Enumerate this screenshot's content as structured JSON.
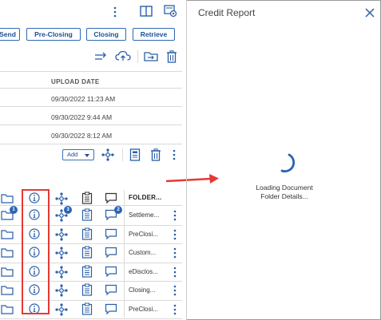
{
  "toolbar": {
    "buttons": [
      "Send",
      "Pre-Closing",
      "Closing",
      "Retrieve"
    ]
  },
  "documents": {
    "column_header": "UPLOAD DATE",
    "dates": [
      "09/30/2022 11:23 AM",
      "09/30/2022 9:44 AM",
      "09/30/2022 8:12 AM"
    ],
    "add_label": "Add"
  },
  "folders": {
    "header": "FOLDER...",
    "rows": [
      {
        "name": "Settleme...",
        "folder_badge": "1",
        "workflow_badge": "3",
        "comment_badge": "2"
      },
      {
        "name": "PreClosi...",
        "folder_badge": "",
        "workflow_badge": "",
        "comment_badge": ""
      },
      {
        "name": "Custom...",
        "folder_badge": "",
        "workflow_badge": "",
        "comment_badge": ""
      },
      {
        "name": "eDisclos...",
        "folder_badge": "",
        "workflow_badge": "",
        "comment_badge": ""
      },
      {
        "name": "Closing...",
        "folder_badge": "",
        "workflow_badge": "",
        "comment_badge": ""
      },
      {
        "name": "PreClosi...",
        "folder_badge": "",
        "workflow_badge": "",
        "comment_badge": ""
      }
    ]
  },
  "panel": {
    "title": "Credit Report",
    "loading_line1": "Loading Document",
    "loading_line2": "Folder Details..."
  },
  "colors": {
    "accent": "#2d69b6",
    "highlight": "#e53935"
  }
}
